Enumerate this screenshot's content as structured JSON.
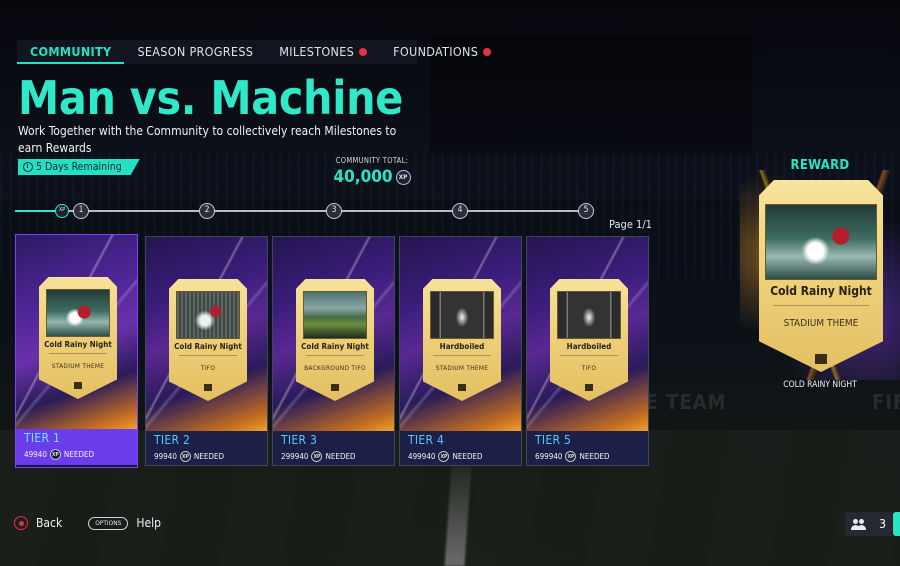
{
  "tabs": [
    {
      "label": "COMMUNITY",
      "active": true,
      "alert": false
    },
    {
      "label": "SEASON PROGRESS",
      "active": false,
      "alert": false
    },
    {
      "label": "MILESTONES",
      "active": false,
      "alert": true
    },
    {
      "label": "FOUNDATIONS",
      "active": false,
      "alert": true
    }
  ],
  "header": {
    "title": "Man vs. Machine",
    "description": "Work Together with the Community to collectively reach Milestones to earn Rewards",
    "days_remaining": "5 Days Remaining"
  },
  "community_total": {
    "label": "COMMUNITY TOTAL:",
    "value": "40,000",
    "unit": "XP"
  },
  "progress": {
    "start_label": "XP",
    "nodes": [
      "1",
      "2",
      "3",
      "4",
      "5"
    ],
    "page_label": "Page 1/1"
  },
  "tiers": [
    {
      "tier": "TIER 1",
      "needed": "49940",
      "needed_suffix": "NEEDED",
      "item": "Cold Rainy Night",
      "type": "STADIUM THEME",
      "selected": true
    },
    {
      "tier": "TIER 2",
      "needed": "99940",
      "needed_suffix": "NEEDED",
      "item": "Cold Rainy Night",
      "type": "TIFO",
      "selected": false
    },
    {
      "tier": "TIER 3",
      "needed": "299940",
      "needed_suffix": "NEEDED",
      "item": "Cold Rainy Night",
      "type": "BACKGROUND TIFO",
      "selected": false
    },
    {
      "tier": "TIER 4",
      "needed": "499940",
      "needed_suffix": "NEEDED",
      "item": "Hardboiled",
      "type": "STADIUM THEME",
      "selected": false
    },
    {
      "tier": "TIER 5",
      "needed": "699940",
      "needed_suffix": "NEEDED",
      "item": "Hardboiled",
      "type": "TIFO",
      "selected": false
    }
  ],
  "reward": {
    "title": "REWARD",
    "item": "Cold Rainy Night",
    "type": "STADIUM THEME",
    "caption": "COLD RAINY NIGHT"
  },
  "footer": {
    "back_label": "Back",
    "options_label": "OPTIONS",
    "help_label": "Help",
    "friends_count": "3"
  },
  "background_text": {
    "watermark_left": "MATE TEAM",
    "watermark_right": "FIF"
  },
  "colors": {
    "accent": "#2fe8c8",
    "selected_tier": "#7b43ff",
    "alert": "#e23246",
    "tier_label": "#54c9ff"
  },
  "icons": {
    "days": "clock-icon",
    "xp": "xp-badge-icon",
    "card_type": "image-icon",
    "back": "circle-button-icon",
    "friends": "friends-icon"
  }
}
